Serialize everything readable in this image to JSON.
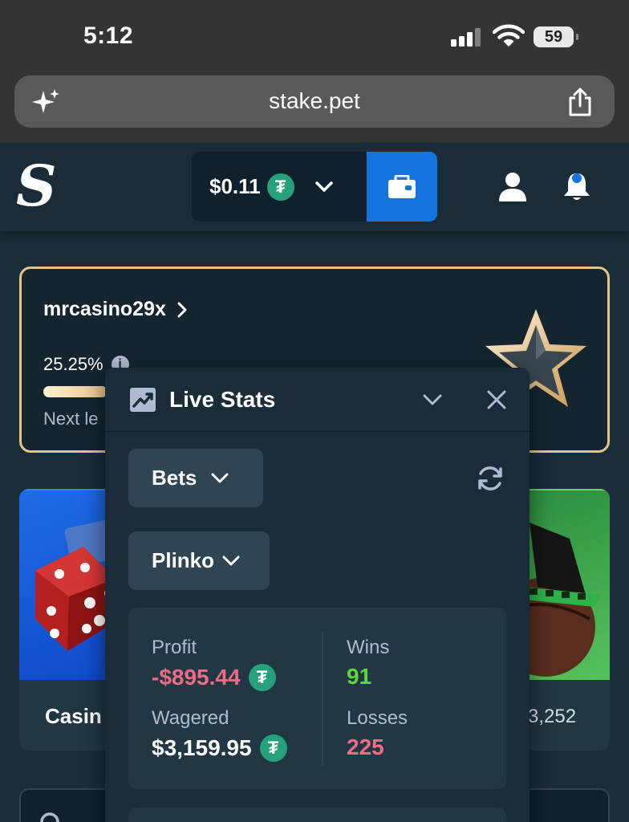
{
  "status_bar": {
    "time": "5:12",
    "battery": "59"
  },
  "browser": {
    "url": "stake.pet"
  },
  "header": {
    "logo": "S",
    "wallet_amount": "$0.11",
    "currency_symbol": "₮",
    "accent": "#1475e1"
  },
  "vip": {
    "username": "mrcasino29x",
    "progress_text": "25.25%",
    "progress": 0.2525,
    "next_level_text": "Next le",
    "border_color": "#e5c48c"
  },
  "tiles": {
    "left_label": "Casin",
    "right_count": "3,252"
  },
  "live_stats": {
    "title": "Live Stats",
    "bets_label": "Bets",
    "game_label": "Plinko",
    "profit_label": "Profit",
    "profit_value": "-$895.44",
    "wagered_label": "Wagered",
    "wagered_value": "$3,159.95",
    "wins_label": "Wins",
    "wins_value": "91",
    "losses_label": "Losses",
    "losses_value": "225",
    "colors": {
      "negative": "#ed6e84",
      "positive": "#5cd83a"
    }
  }
}
